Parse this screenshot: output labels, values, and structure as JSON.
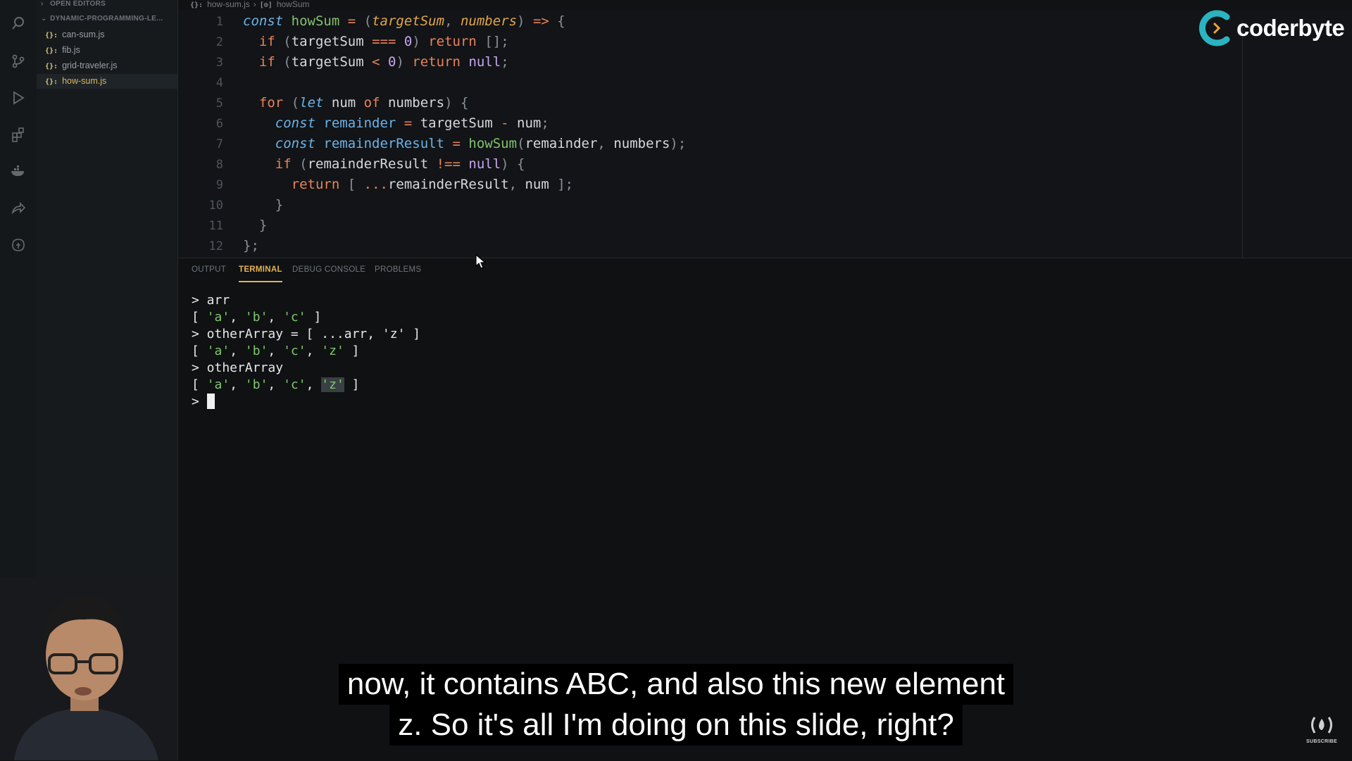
{
  "sidebar": {
    "open_editors_label": "OPEN EDITORS",
    "folder_label": "DYNAMIC-PROGRAMMING-LE...",
    "files": [
      {
        "badge": "{}:",
        "name": "can-sum.js"
      },
      {
        "badge": "{}:",
        "name": "fib.js"
      },
      {
        "badge": "{}:",
        "name": "grid-traveler.js"
      },
      {
        "badge": "{}:",
        "name": "how-sum.js"
      }
    ]
  },
  "breadcrumb": {
    "file_badge": "{}:",
    "file": "how-sum.js",
    "symbol_badge": "[⊙]",
    "symbol": "howSum"
  },
  "editor": {
    "line_numbers": [
      "1",
      "2",
      "3",
      "4",
      "5",
      "6",
      "7",
      "8",
      "9",
      "10",
      "11",
      "12"
    ]
  },
  "panel": {
    "tabs": [
      "OUTPUT",
      "TERMINAL",
      "DEBUG CONSOLE",
      "PROBLEMS"
    ],
    "active_tab": "TERMINAL",
    "terminal_lines": [
      "> arr",
      "[ 'a', 'b', 'c' ]",
      "> otherArray = [ ...arr, 'z' ]",
      "[ 'a', 'b', 'c', 'z' ]",
      "> otherArray",
      "[ 'a', 'b', 'c', 'z' ]",
      ">"
    ]
  },
  "logo": {
    "text": "coderbyte",
    "color": "#2bb3c0"
  },
  "captions": {
    "line1": "now, it contains ABC, and also this new element",
    "line2": "z. So it's all I'm doing on this slide, right?"
  },
  "subscribe": {
    "label": "SUBSCRIBE"
  },
  "colors": {
    "accent_tab": "#e6b34f",
    "string": "#7fc96b",
    "keyword": "#e9835a",
    "function": "#82c26f"
  }
}
